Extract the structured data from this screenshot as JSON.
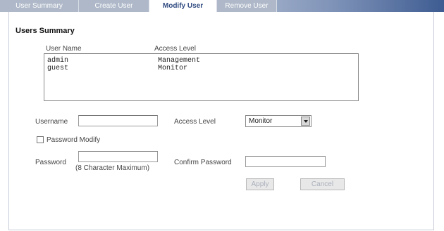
{
  "tabs": [
    {
      "label": "User Summary"
    },
    {
      "label": "Create User"
    },
    {
      "label": "Modify User"
    },
    {
      "label": "Remove User"
    }
  ],
  "summary": {
    "title": "Users Summary",
    "col_user": "User Name",
    "col_access": "Access Level",
    "rows": [
      {
        "user": "admin",
        "access": "Management"
      },
      {
        "user": "guest",
        "access": "Monitor"
      }
    ]
  },
  "form": {
    "username_label": "Username",
    "username_value": "",
    "access_label": "Access Level",
    "access_selected": "Monitor",
    "password_modify_label": "Password Modify",
    "password_modify_checked": false,
    "password_label": "Password",
    "password_value": "",
    "password_hint": "(8 Character Maximum)",
    "confirm_label": "Confirm Password",
    "confirm_value": "",
    "apply_label": "Apply",
    "cancel_label": "Cancel"
  }
}
